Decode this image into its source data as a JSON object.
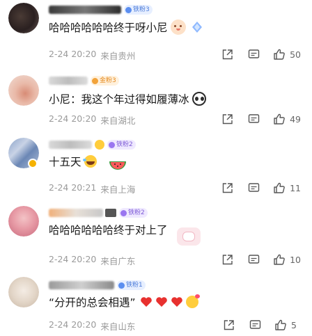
{
  "comments": [
    {
      "badge": "铁粉3",
      "text": "哈哈哈哈哈哈终于呀小尼",
      "date": "2-24 20:20",
      "location": "来自贵州",
      "likes": "50"
    },
    {
      "badge": "金粉3",
      "text": "小尼：我这个年过得如履薄冰",
      "date": "2-24 20:20",
      "location": "来自湖北",
      "likes": "49"
    },
    {
      "badge": "铁粉2",
      "text": "十五天",
      "date": "2-24 20:21",
      "location": "来自上海",
      "likes": "11"
    },
    {
      "badge": "铁粉2",
      "text": "哈哈哈哈哈哈终于对上了",
      "date": "2-24 20:20",
      "location": "来自广东",
      "likes": "10"
    },
    {
      "badge": "铁粉1",
      "text": "“分开的总会相遇”",
      "date": "2-24 20:20",
      "location": "来自山东",
      "likes": "5"
    }
  ],
  "icons": {
    "share": "share-icon",
    "comment": "comment-icon",
    "like": "thumbs-up-icon"
  },
  "colors": {
    "meta_text": "#9a9a9a",
    "heart": "#e8312f"
  }
}
